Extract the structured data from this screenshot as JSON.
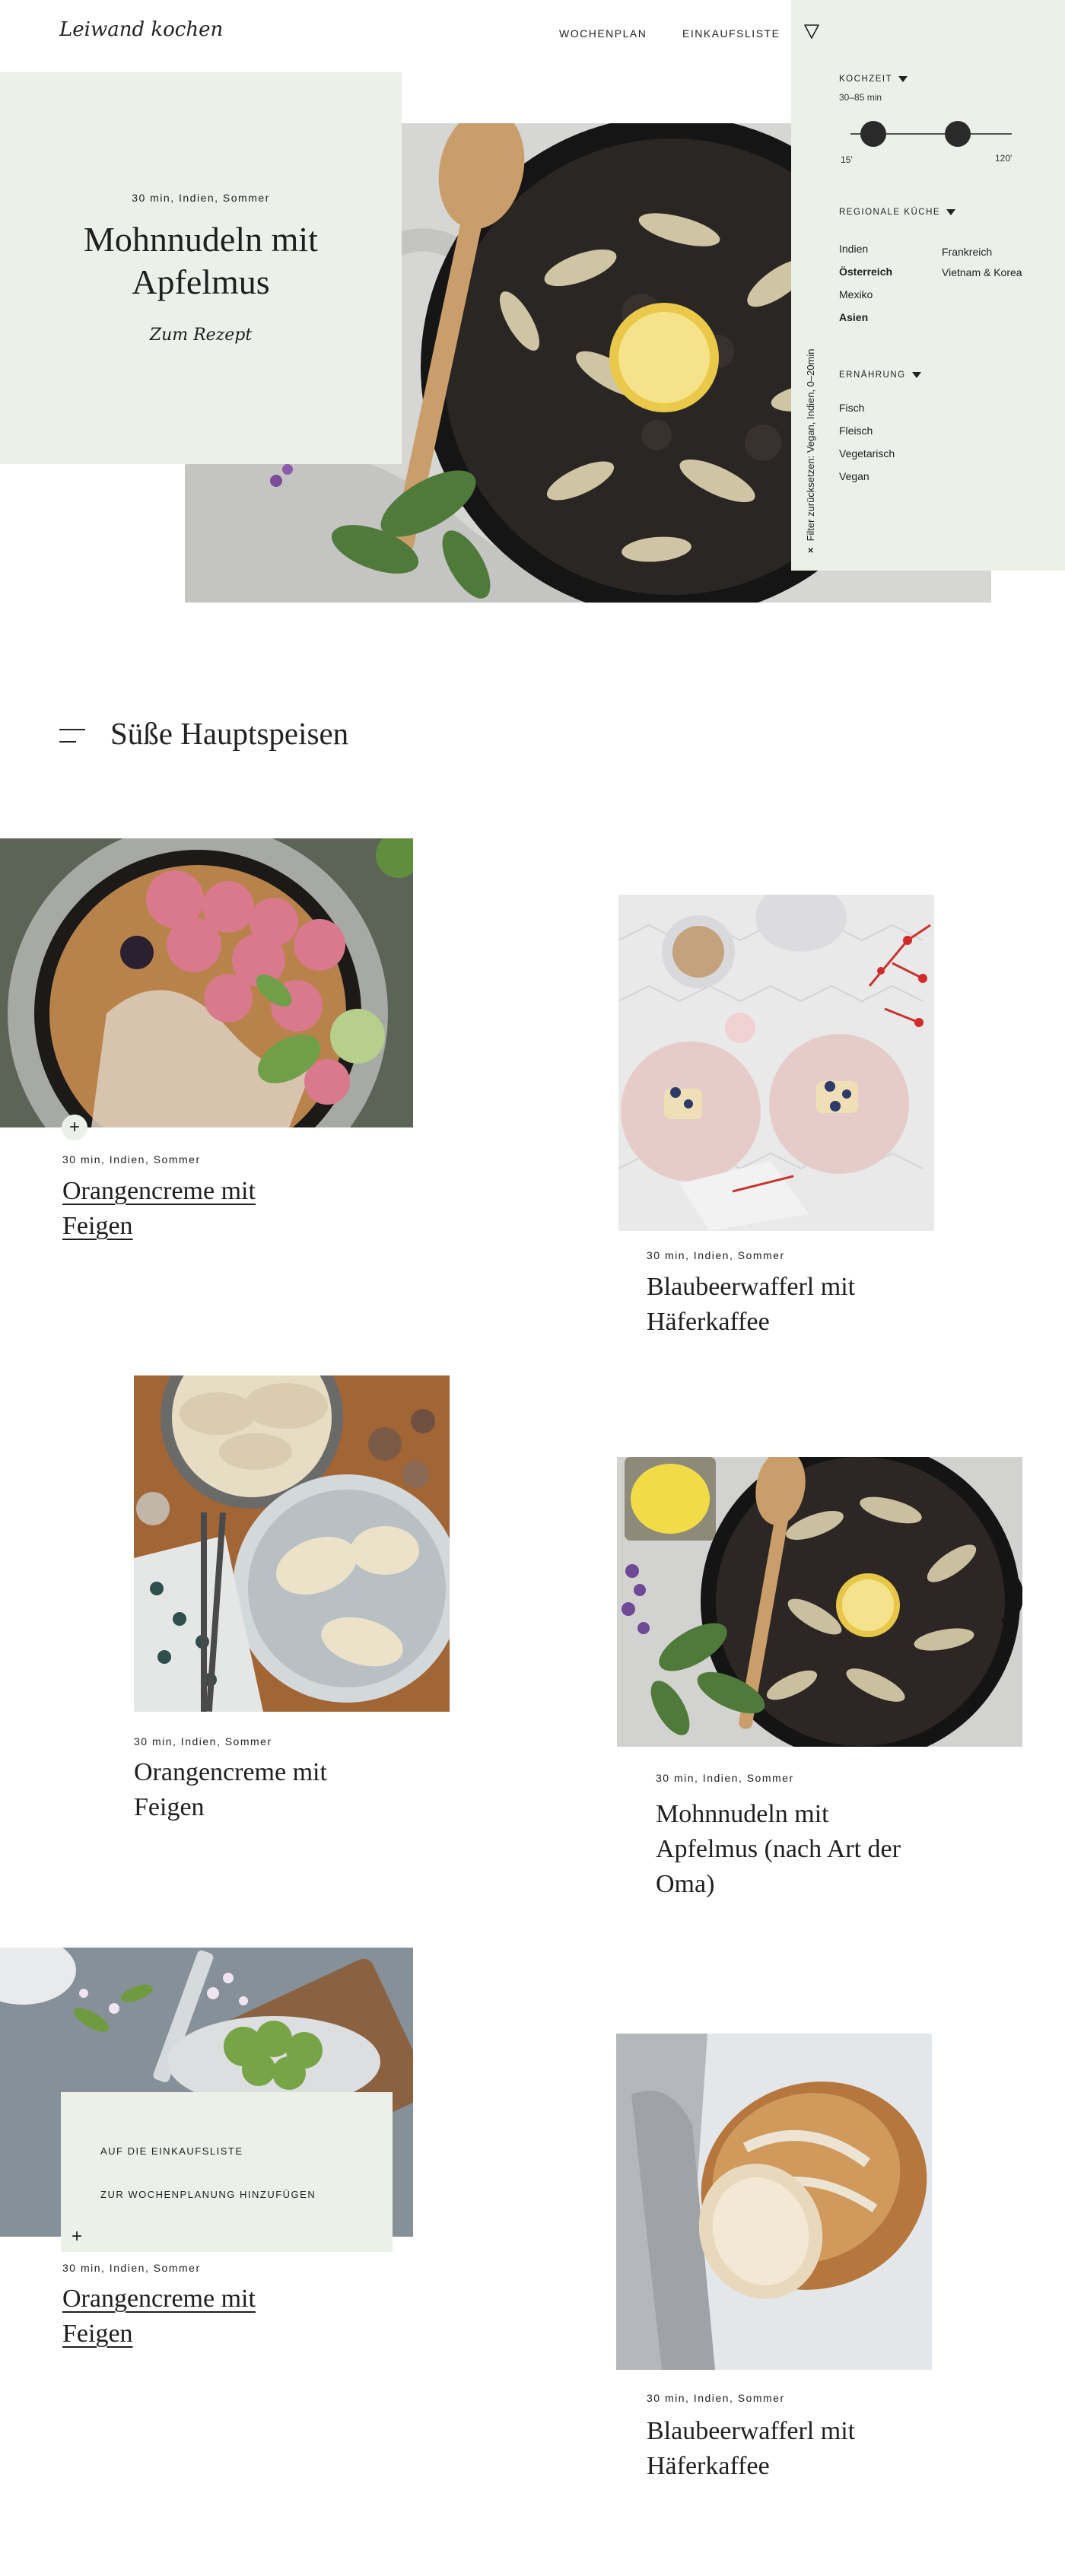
{
  "header": {
    "logo": "Leiwand kochen",
    "nav": [
      "WOCHENPLAN",
      "EINKAUFSLISTE"
    ]
  },
  "filters": {
    "kochzeit": {
      "label": "KOCHZEIT",
      "range": "30–85 min",
      "min_label": "15'",
      "max_label": "120'",
      "min_value": 30,
      "max_value": 85,
      "scale_min": 15,
      "scale_max": 120
    },
    "regional": {
      "label": "REGIONALE KÜCHE",
      "col1": [
        "Indien",
        "Österreich",
        "Mexiko",
        "Asien"
      ],
      "col2": [
        "Frankreich",
        "Vietnam & Korea"
      ],
      "selected": [
        "Österreich",
        "Asien"
      ]
    },
    "ernaehrung": {
      "label": "ERNÄHRUNG",
      "items": [
        "Fisch",
        "Fleisch",
        "Vegetarisch",
        "Vegan"
      ]
    },
    "reset": "Filter zurücksetzen: Vegan, Indien, 0–20min",
    "reset_close": "×"
  },
  "hero": {
    "meta": "30 min, Indien, Sommer",
    "title_line1": "Mohnnudeln mit",
    "title_line2": "Apfelmus",
    "cta": "Zum Rezept"
  },
  "section": {
    "title": "Süße Hauptspeisen"
  },
  "recipes": [
    {
      "meta": "30 min, Indien, Sommer",
      "title_line1": "Orangencreme mit",
      "title_line2": "Feigen",
      "title_line3": ""
    },
    {
      "meta": "30 min, Indien, Sommer",
      "title_line1": "Blaubeerwafferl mit",
      "title_line2": "Häferkaffee",
      "title_line3": ""
    },
    {
      "meta": "30 min, Indien, Sommer",
      "title_line1": "Orangencreme mit",
      "title_line2": "Feigen",
      "title_line3": ""
    },
    {
      "meta": "30 min, Indien, Sommer",
      "title_line1": "Mohnnudeln mit",
      "title_line2": "Apfelmus (nach Art der",
      "title_line3": "Oma)"
    },
    {
      "meta": "30 min, Indien, Sommer",
      "title_line1": "Orangencreme mit",
      "title_line2": "Feigen",
      "title_line3": ""
    },
    {
      "meta": "30 min, Indien, Sommer",
      "title_line1": "Blaubeerwafferl mit",
      "title_line2": "Häferkaffee",
      "title_line3": ""
    }
  ],
  "popup": {
    "items": [
      "AUF DIE EINKAUFSLISTE",
      "ZUR WOCHENPLANUNG HINZUFÜGEN"
    ]
  },
  "icons": {
    "plus": "+",
    "filter": "filter-triangle-icon",
    "menu": "menu-lines-icon"
  },
  "colors": {
    "panel": "#ebf0e9",
    "text": "#1f1f1f",
    "handle": "#2a2a2a"
  }
}
